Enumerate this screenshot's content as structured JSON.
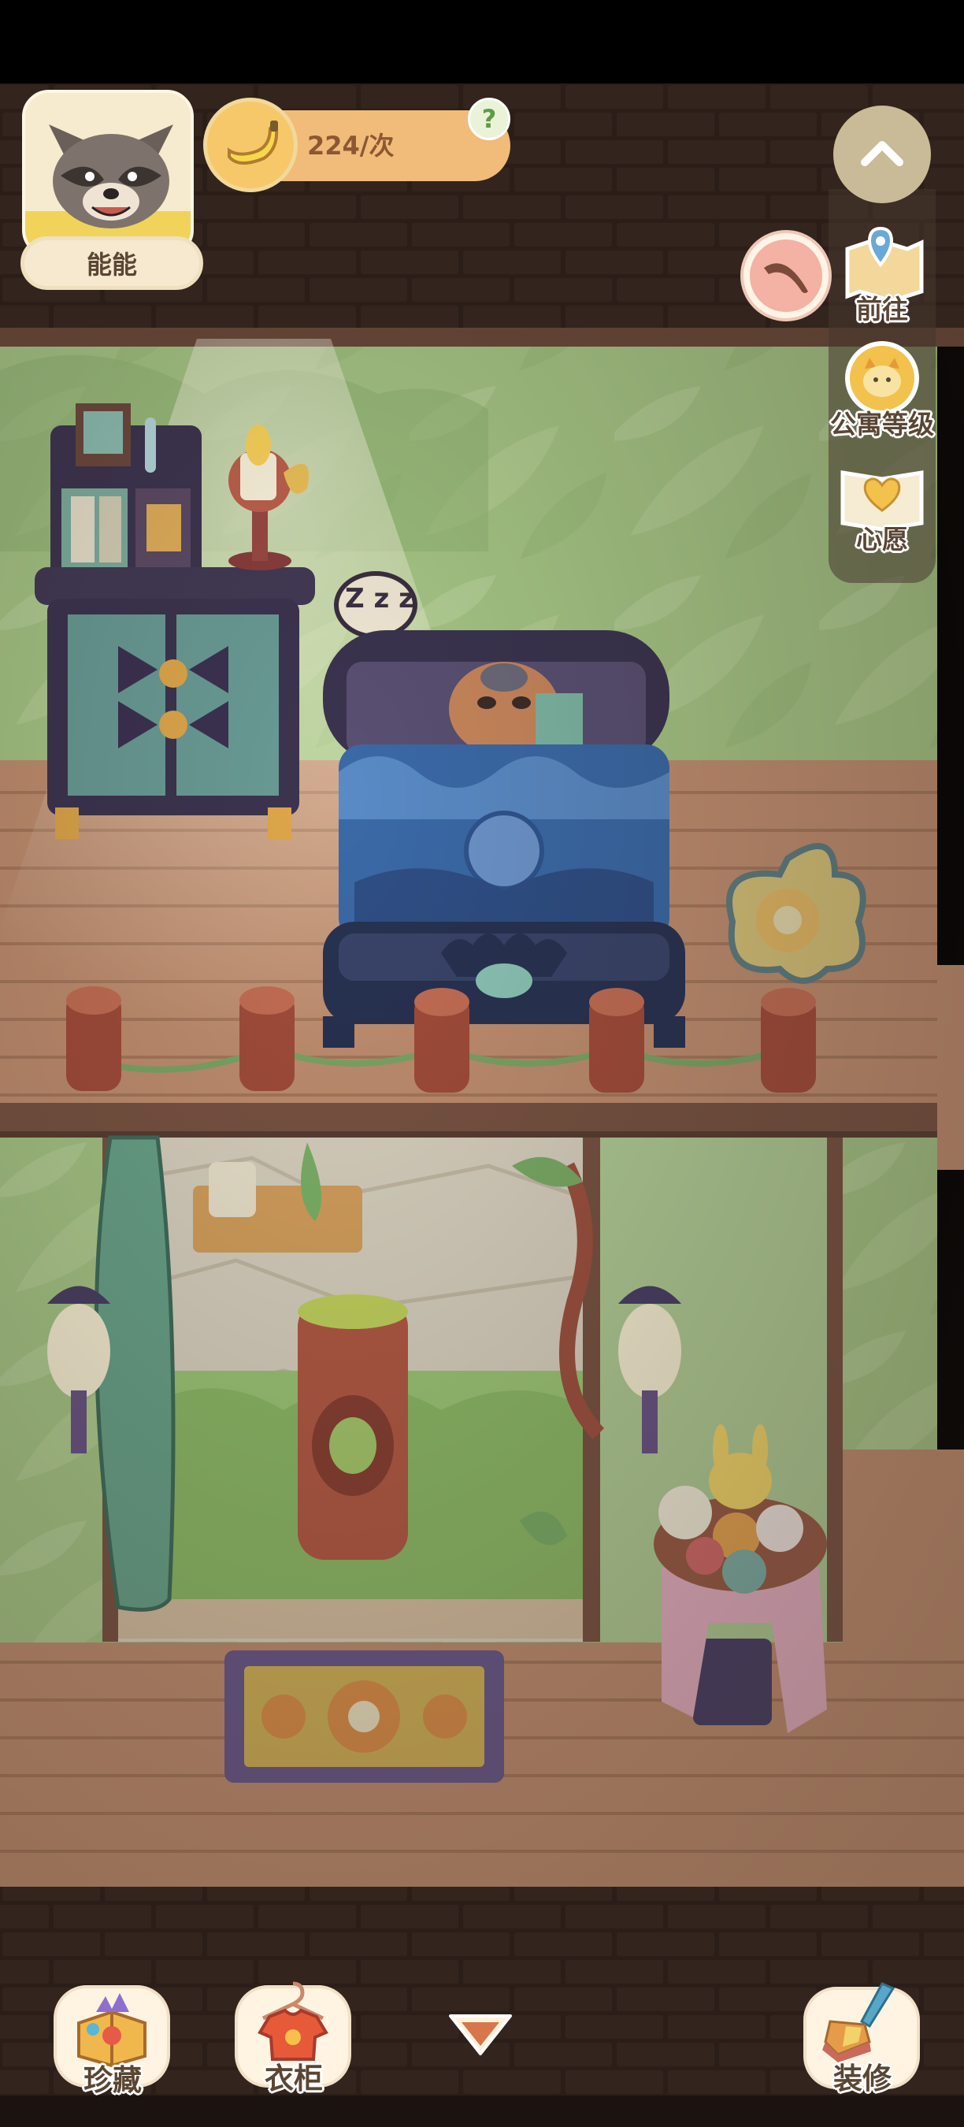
{
  "player": {
    "name": "能能"
  },
  "currency": {
    "amount_label": "224/次",
    "help_symbol": "?"
  },
  "side_menu": {
    "goto_label": "前往",
    "apartment_level_label": "公寓等级",
    "wish_label": "心愿"
  },
  "sleep_text": "Z z z",
  "bottom_bar": {
    "collection_label": "珍藏",
    "wardrobe_label": "衣柜",
    "decorate_label": "装修"
  },
  "icons": {
    "collapse": "chevron-up-icon",
    "expand": "triangle-down-icon",
    "boomerang": "boomerang-icon",
    "map_pin": "map-pin-icon",
    "cat_badge": "cat-badge-icon",
    "heart_book": "heart-book-icon",
    "treasure_box": "treasure-box-icon",
    "shirt": "shirt-icon",
    "paint_brush": "paint-brush-icon",
    "banana": "banana-icon"
  },
  "colors": {
    "wall_brick": "#2a1d17",
    "floor_wood": "#c79472",
    "room_green": "#a9c98a",
    "accent_orange": "#f1bb7a",
    "text_brown": "#5a4634"
  }
}
